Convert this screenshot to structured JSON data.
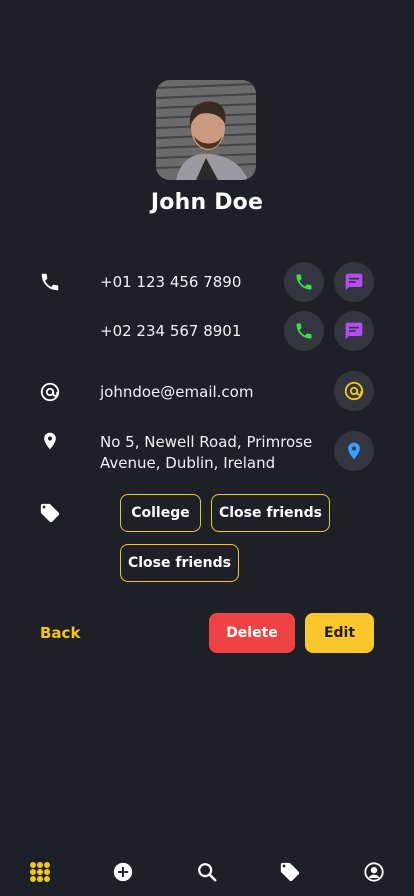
{
  "contact": {
    "name": "John Doe",
    "phones": [
      "+01 123 456 7890",
      "+02 234 567 8901"
    ],
    "email": "johndoe@email.com",
    "address_line1": "No 5, Newell Road, Primrose",
    "address_line2": "Avenue, Dublin, Ireland",
    "tags": [
      "College",
      "Close friends",
      "Close friends"
    ]
  },
  "actions": {
    "back_label": "Back",
    "delete_label": "Delete",
    "edit_label": "Edit"
  },
  "icons": {
    "phone": "phone-icon",
    "message": "message-icon",
    "email": "at-icon",
    "location": "location-pin-icon",
    "tag": "tag-icon"
  },
  "tabbar": {
    "items": [
      "grid-icon",
      "add-circle-icon",
      "search-icon",
      "tag-icon",
      "profile-icon"
    ],
    "active_index": 0
  },
  "colors": {
    "background": "#1e2028",
    "accent_yellow": "#f5c518",
    "call_green": "#3ddc4a",
    "message_purple": "#b44cf0",
    "delete_red": "#f04444",
    "location_blue": "#3aa0ff"
  }
}
